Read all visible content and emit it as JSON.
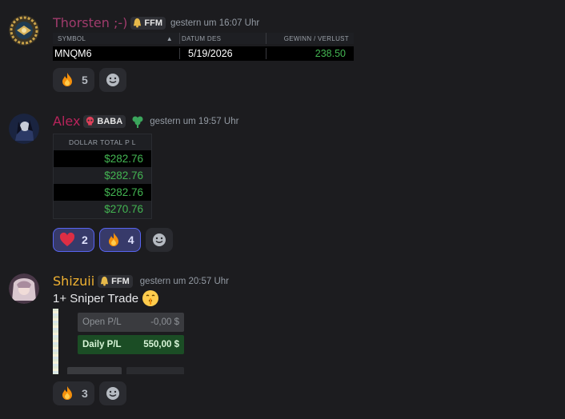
{
  "messages": [
    {
      "username": "Thorsten ;-)",
      "username_color": "#a03b6c",
      "tag": "FFM",
      "timestamp": "gestern um 16:07 Uhr",
      "table": {
        "headers": [
          "SYMBOL",
          "DATUM DES",
          "GEWINN / VERLUST"
        ],
        "sort_indicator": "▲",
        "rows": [
          [
            "MNQM6",
            "5/19/2026",
            "238.50"
          ]
        ]
      },
      "reactions": [
        {
          "emoji": "fire-emoji",
          "count": "5",
          "active": false
        }
      ]
    },
    {
      "username": "Alex",
      "username_color": "#b8245b",
      "tag": "BABA",
      "timestamp": "gestern um 19:57 Uhr",
      "table": {
        "header": "DOLLAR TOTAL P L",
        "values": [
          "$282.76",
          "$282.76",
          "$282.76",
          "$270.76"
        ]
      },
      "reactions": [
        {
          "emoji": "heart-emoji",
          "count": "2",
          "active": true
        },
        {
          "emoji": "fire-emoji",
          "count": "4",
          "active": true
        }
      ]
    },
    {
      "username": "Shizuii",
      "username_color": "#f0b232",
      "tag": "FFM",
      "timestamp": "gestern um 20:57 Uhr",
      "text": "1+ Sniper Trade",
      "embed": {
        "open_label": "Open P/L",
        "open_value": "-0,00 $",
        "daily_label": "Daily P/L",
        "daily_value": "550,00 $"
      },
      "reactions": [
        {
          "emoji": "fire-emoji",
          "count": "3",
          "active": false
        }
      ]
    }
  ],
  "colors": {
    "background": "#1c1c1f",
    "profit_green": "#43b552",
    "reaction_active": "#5865f2"
  }
}
